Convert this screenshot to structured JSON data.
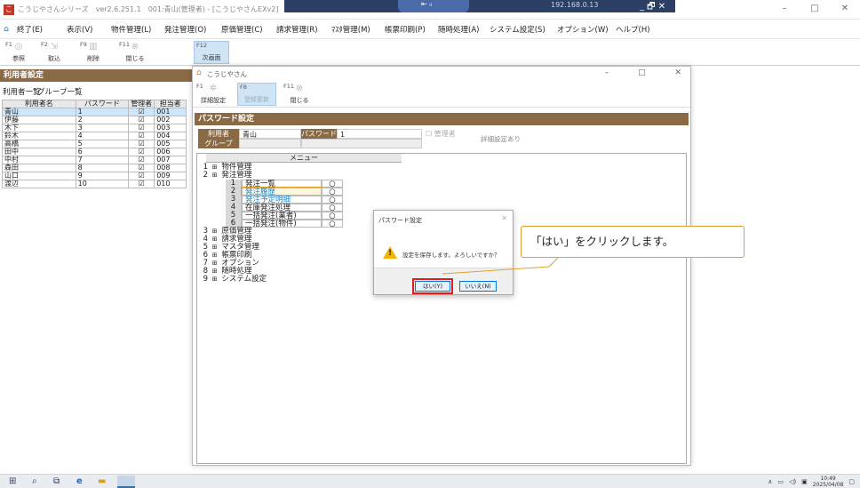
{
  "window": {
    "title": "こうじやさんシリーズ　ver2.6.251.1　001:青山(管理者) - [こうじやさんEXv2]",
    "ctrl_min": "–",
    "ctrl_max": "□",
    "ctrl_close": "✕"
  },
  "remote": {
    "ip": "192.168.0.13",
    "ctrl": "_ 🗗 ✕",
    "signal": "⇤ ᵢₗ"
  },
  "menubar": {
    "items": [
      "終了(E)",
      "表示(V)",
      "物件管理(L)",
      "発注管理(O)",
      "原価管理(C)",
      "請求管理(R)",
      "ﾏｽﾀ管理(M)",
      "帳票印刷(P)",
      "随時処理(A)",
      "システム設定(S)",
      "オプション(W)",
      "ヘルプ(H)"
    ]
  },
  "toolbar": {
    "items": [
      {
        "fk": "F1",
        "label": "参照"
      },
      {
        "fk": "F2",
        "label": "取込"
      },
      {
        "fk": "F9",
        "label": "削除"
      },
      {
        "fk": "F11",
        "label": "閉じる"
      },
      {
        "fk": "F12",
        "label": "次画面"
      }
    ]
  },
  "users": {
    "header": "利用者設定",
    "tabs": [
      "利用者一覧",
      "グループ一覧"
    ],
    "columns": [
      "利用者名",
      "パスワード",
      "管理者",
      "担当者"
    ],
    "rows": [
      {
        "name": "青山",
        "pw": "1",
        "code": "001"
      },
      {
        "name": "伊藤",
        "pw": "2",
        "code": "002"
      },
      {
        "name": "木下",
        "pw": "3",
        "code": "003"
      },
      {
        "name": "鈴木",
        "pw": "4",
        "code": "004"
      },
      {
        "name": "高橋",
        "pw": "5",
        "code": "005"
      },
      {
        "name": "田中",
        "pw": "6",
        "code": "006"
      },
      {
        "name": "中村",
        "pw": "7",
        "code": "007"
      },
      {
        "name": "森田",
        "pw": "8",
        "code": "008"
      },
      {
        "name": "山口",
        "pw": "9",
        "code": "009"
      },
      {
        "name": "渡辺",
        "pw": "10",
        "code": "010"
      }
    ]
  },
  "dialog": {
    "title": "こうじやさん",
    "ctrl": "– □ ✕",
    "toolbar": [
      {
        "fk": "F1",
        "label": "詳細設定"
      },
      {
        "fk": "F8",
        "label": "登録更新"
      },
      {
        "fk": "F11",
        "label": "閉じる"
      }
    ],
    "header": "パスワード設定",
    "user_label": "利用者",
    "user_value": "青山",
    "pw_label": "パスワード",
    "pw_value": "1",
    "admin_label": "管理者",
    "detail_text": "詳細設定あり",
    "group_label": "グループ",
    "menu_head": "メニュー",
    "menus": [
      {
        "num": "1",
        "label": "物件管理"
      },
      {
        "num": "2",
        "label": "発注管理"
      },
      {
        "num": "3",
        "label": "原価管理"
      },
      {
        "num": "4",
        "label": "請求管理"
      },
      {
        "num": "5",
        "label": "マスタ管理"
      },
      {
        "num": "6",
        "label": "帳票印刷"
      },
      {
        "num": "7",
        "label": "オプション"
      },
      {
        "num": "8",
        "label": "随時処理"
      },
      {
        "num": "9",
        "label": "システム設定"
      }
    ],
    "submenus": [
      {
        "num": "1",
        "label": "発注一覧",
        "mark": "○"
      },
      {
        "num": "2",
        "label": "発注履歴",
        "mark": "○"
      },
      {
        "num": "3",
        "label": "発注予定明細",
        "mark": "○"
      },
      {
        "num": "4",
        "label": "在庫発注処理",
        "mark": "○"
      },
      {
        "num": "5",
        "label": "一括発注(業者)",
        "mark": "○"
      },
      {
        "num": "6",
        "label": "一括発注(物件)",
        "mark": "○"
      }
    ]
  },
  "confirm": {
    "title": "パスワード設定",
    "close": "✕",
    "message": "設定を保存します。よろしいですか？",
    "yes": "はい(Y)",
    "no": "いいえ(N)"
  },
  "callout": {
    "text": "「はい」をクリックします。"
  },
  "taskbar": {
    "time": "10:49",
    "date": "2025/04/08"
  },
  "colors": {
    "header_brown": "#8a6a44",
    "remote_blue": "#2b3f64",
    "highlight_red": "#e51a1a",
    "link_blue": "#1a8ad4"
  }
}
